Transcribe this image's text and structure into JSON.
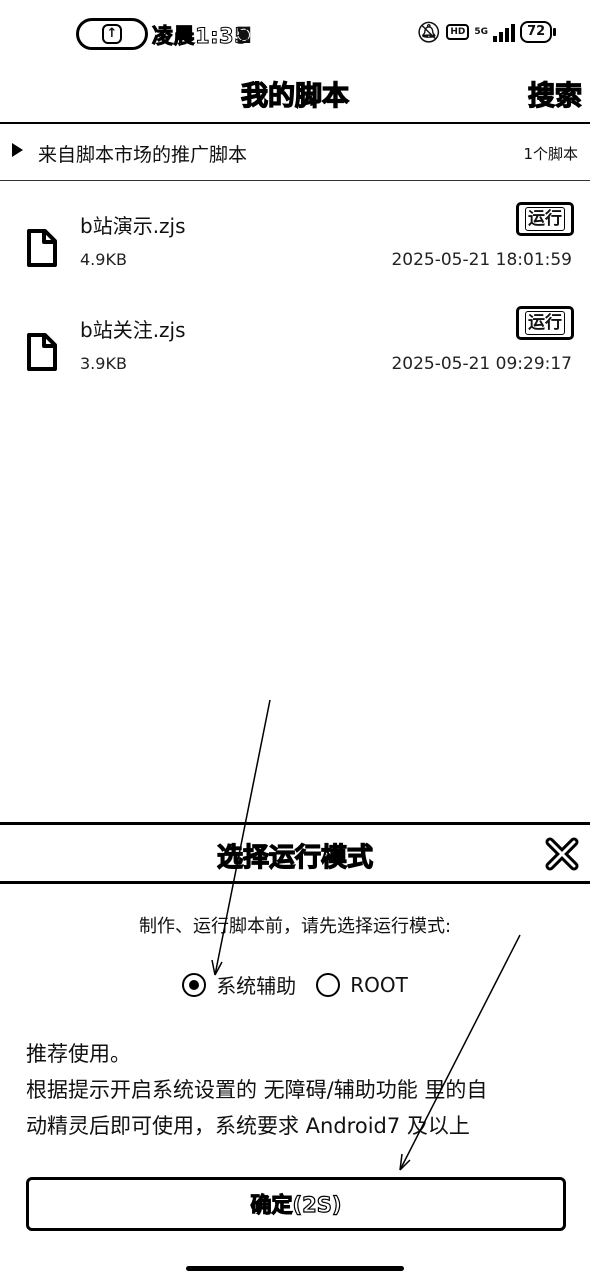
{
  "status_bar": {
    "time": "凌晨1:35",
    "battery": "72"
  },
  "header": {
    "title": "我的脚本",
    "search_label": "搜索"
  },
  "promo": {
    "label": "来自脚本市场的推广脚本",
    "count": "1个脚本"
  },
  "scripts": [
    {
      "name": "b站演示.zjs",
      "size": "4.9KB",
      "modified": "2025-05-21 18:01:59",
      "run_label": "运行"
    },
    {
      "name": "b站关注.zjs",
      "size": "3.9KB",
      "modified": "2025-05-21 09:29:17",
      "run_label": "运行"
    }
  ],
  "dialog": {
    "title": "选择运行模式",
    "prompt": "制作、运行脚本前，请先选择运行模式:",
    "options": [
      {
        "label": "系统辅助",
        "selected": true
      },
      {
        "label": "ROOT",
        "selected": false
      }
    ],
    "desc_line1": "推荐使用。",
    "desc_line2": "根据提示开启系统设置的 无障碍/辅助功能 里的自",
    "desc_line3": "动精灵后即可使用，系统要求 Android7 及以上",
    "confirm_label": "确定(2S)"
  }
}
